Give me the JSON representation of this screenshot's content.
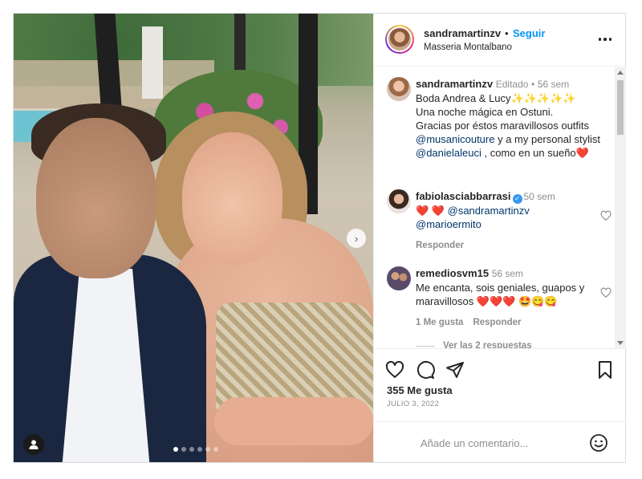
{
  "post": {
    "username": "sandramartinzv",
    "separator": "•",
    "follow_label": "Seguir",
    "location": "Masseria Montalbano",
    "photo_dots": 6,
    "photo_dot_active": 0
  },
  "caption": {
    "username": "sandramartinzv",
    "edited_label": "Editado",
    "sep": "•",
    "time": "56 sem",
    "line1": "Boda Andrea & Lucy",
    "sparkles": "✨✨✨✨✨",
    "line2": "Una noche mágica en Ostuni.",
    "line3": "Gracias por éstos maravillosos outfits",
    "mention1": "@musanicouture",
    "line4_rest": " y a my personal stylist",
    "mention2": "@danielaleuci",
    "line5_rest": " , como en un sueño",
    "line5_emoji": "❤️"
  },
  "comments": [
    {
      "username": "fabiolasciabbarrasi",
      "verified": true,
      "time": "50 sem",
      "hearts": "❤️ ❤️",
      "mention1": "@sandramartinzv",
      "mention2": "@marioermito",
      "reply_label": "Responder"
    },
    {
      "username": "remediosvm15",
      "time": "56 sem",
      "text": "Me encanta, sois geniales, guapos y maravillosos",
      "emojis": "❤️❤️❤️ 🤩😋😋",
      "likes_label": "1 Me gusta",
      "reply_label": "Responder",
      "view_replies": "Ver las 2 respuestas"
    }
  ],
  "actions": {
    "likes": "355 Me gusta",
    "date": "JULIO 3, 2022"
  },
  "add_comment": {
    "placeholder": "Añade un comentario..."
  },
  "icons": {
    "more": "more-options-icon",
    "like": "heart-icon",
    "comment": "comment-icon",
    "share": "send-icon",
    "save": "bookmark-icon",
    "emoji": "emoji-icon",
    "tag": "user-tag-icon",
    "next": "chevron-right-icon"
  },
  "colors": {
    "accent": "#0095f6",
    "mention": "#00376b",
    "muted": "#8e8e8e",
    "text": "#262626",
    "verified": "#3897f0"
  }
}
